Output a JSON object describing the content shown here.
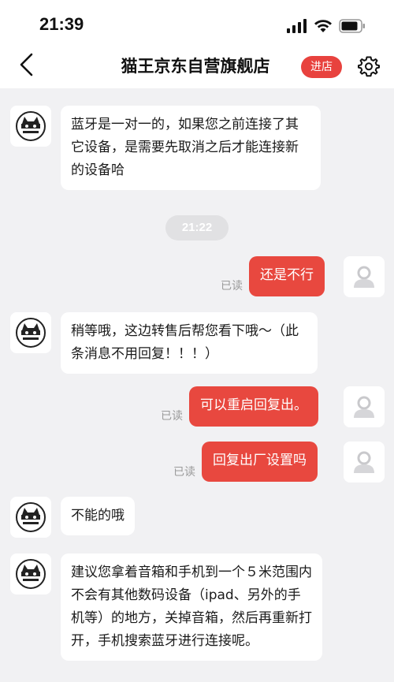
{
  "status": {
    "time": "21:39"
  },
  "header": {
    "title": "猫王京东自营旗舰店",
    "enter_label": "进店"
  },
  "colors": {
    "accent": "#e8483f",
    "background": "#f1f1f3"
  },
  "timestamp_divider": "21:22",
  "messages": [
    {
      "side": "left",
      "text": "蓝牙是一对一的，如果您之前连接了其它设备，是需要先取消之后才能连接新的设备哈"
    },
    {
      "side": "right",
      "text": "还是不行",
      "read": "已读"
    },
    {
      "side": "left",
      "text": "稍等哦，这边转售后帮您看下哦～（此条消息不用回复！！！）"
    },
    {
      "side": "right",
      "text": "可以重启回复出。",
      "read": "已读"
    },
    {
      "side": "right",
      "text": "回复出厂设置吗",
      "read": "已读"
    },
    {
      "side": "left",
      "text": "不能的哦"
    },
    {
      "side": "left",
      "text": "建议您拿着音箱和手机到一个５米范围内不会有其他数码设备（ipad、另外的手机等）的地方，关掉音箱，然后再重新打开，手机搜索蓝牙进行连接呢。"
    }
  ]
}
